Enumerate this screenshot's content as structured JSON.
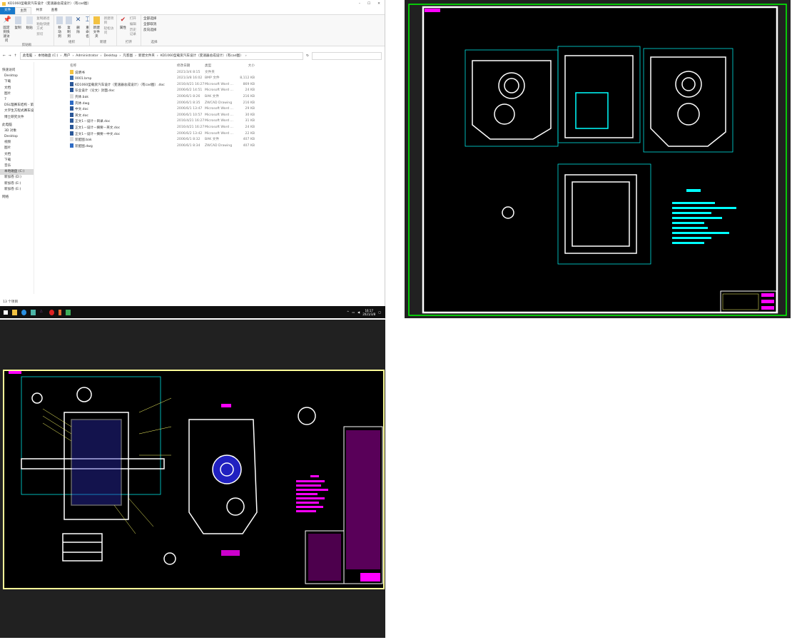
{
  "explorer": {
    "title": "KD1060型载货汽车设计（变速器总成设计）（有cad图）",
    "window_controls": [
      "–",
      "☐",
      "✕"
    ],
    "tabs": [
      "文件",
      "主页",
      "共享",
      "查看"
    ],
    "ribbon": {
      "clipboard": {
        "label": "剪贴板",
        "pin": "固定到快速访问",
        "copy": "复制",
        "paste": "粘贴",
        "copy_path": "复制路径",
        "paste_shortcut": "粘贴快捷方式",
        "cut": "剪切"
      },
      "organize": {
        "label": "组织",
        "move_to": "移动到",
        "copy_to": "复制到",
        "delete": "删除",
        "rename": "重命名"
      },
      "new": {
        "label": "新建",
        "new_folder": "新建文件夹",
        "new_item": "新建项目",
        "easy_access": "轻松访问"
      },
      "open": {
        "label": "打开",
        "properties": "属性",
        "open": "打开",
        "edit": "编辑",
        "history": "历史记录"
      },
      "select": {
        "label": "选择",
        "select_all": "全部选择",
        "select_none": "全部取消",
        "invert": "反向选择"
      }
    },
    "breadcrumb": [
      "此电脑",
      "本地磁盘 (C:)",
      "用户",
      "Administrator",
      "Desktop",
      "凡客图",
      "新建文件夹",
      "KD1060型载货汽车设计（变速器总成设计）（有cad图）"
    ],
    "nav": [
      "快速访问",
      "Desktop",
      "下载",
      "文档",
      "图片",
      "7",
      "DSL理赛车结构 - 第",
      "大学生方程式赛车设",
      "博士研究文件",
      "此电脑",
      "3D 对象",
      "Desktop",
      "视频",
      "图片",
      "文档",
      "下载",
      "音乐",
      "本地磁盘 (C:)",
      "新加卷 (D:)",
      "新加卷 (E:)",
      "新加卷 (E:)",
      "网络"
    ],
    "columns": [
      "名称",
      "修改日期",
      "类型",
      "大小"
    ],
    "files": [
      {
        "name": "说明书",
        "date": "2021/3/4 8:15",
        "type": "文件夹",
        "size": "",
        "icon": "folder"
      },
      {
        "name": "0001.bmp",
        "date": "2021/3/8 16:02",
        "type": "BMP 文件",
        "size": "8,112 KB",
        "icon": "image"
      },
      {
        "name": "KD1060型载货汽车设计（变速器总成设计）（有cad图）.doc",
        "date": "2016/4/21 16:27",
        "type": "Microsoft Word ...",
        "size": "869 KB",
        "icon": "word"
      },
      {
        "name": "毕业设计（论文）封面.doc",
        "date": "2006/6/2 14:51",
        "type": "Microsoft Word ...",
        "size": "24 KB",
        "icon": "word"
      },
      {
        "name": "壳体.bak",
        "date": "2006/6/1 8:26",
        "type": "BAK 文件",
        "size": "216 KB",
        "icon": "file"
      },
      {
        "name": "壳体.dwg",
        "date": "2006/6/1 8:35",
        "type": "ZWCAD Drawing",
        "size": "216 KB",
        "icon": "dwg"
      },
      {
        "name": "中文.doc",
        "date": "2006/6/1 13:47",
        "type": "Microsoft Word ...",
        "size": "29 KB",
        "icon": "word"
      },
      {
        "name": "英文.doc",
        "date": "2006/6/1 10:57",
        "type": "Microsoft Word ...",
        "size": "30 KB",
        "icon": "word"
      },
      {
        "name": "正文1－设计－目录.doc",
        "date": "2016/4/21 16:27",
        "type": "Microsoft Word ...",
        "size": "31 KB",
        "icon": "word"
      },
      {
        "name": "正文1－设计－摘要－英文.doc",
        "date": "2016/4/21 16:27",
        "type": "Microsoft Word ...",
        "size": "24 KB",
        "icon": "word"
      },
      {
        "name": "正文1－设计－摘要－中文.doc",
        "date": "2006/6/2 13:42",
        "type": "Microsoft Word ...",
        "size": "22 KB",
        "icon": "word"
      },
      {
        "name": "装配图.bak",
        "date": "2006/6/1 8:32",
        "type": "BAK 文件",
        "size": "407 KB",
        "icon": "file"
      },
      {
        "name": "装配图.dwg",
        "date": "2006/6/1 8:34",
        "type": "ZWCAD Drawing",
        "size": "407 KB",
        "icon": "dwg"
      }
    ],
    "status": "13 个项目",
    "taskbar": {
      "time": "16:17",
      "date": "2021/3/8"
    }
  },
  "colors": {
    "accent": "#1979ca",
    "cad_bg": "#212121",
    "cyan": "#00ffff",
    "magenta": "#ff00ff",
    "yellow": "#ffff66",
    "green": "#00ff00"
  }
}
